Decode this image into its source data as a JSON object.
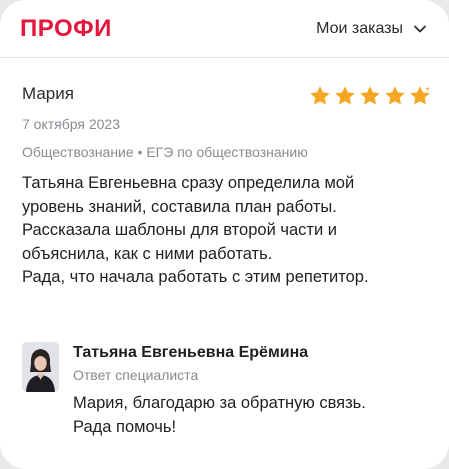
{
  "header": {
    "logo": "ПРОФИ",
    "orders_label": "Мои заказы"
  },
  "review": {
    "author": "Мария",
    "date": "7 октября 2023",
    "tags": "Обществознание • ЕГЭ по обществознанию",
    "rating": 4.5,
    "text_lines": [
      "Татьяна Евгеньевна сразу определила мой",
      "уровень знаний, составила план работы.",
      "Рассказала шаблоны для второй части и",
      "объяснила, как с ними работать.",
      "Рада, что начала работать с этим репетитор."
    ]
  },
  "reply": {
    "name": "Татьяна Евгеньевна Ерёмина",
    "role": "Ответ специалиста",
    "text_lines": [
      "Мария, благодарю за обратную связь.",
      "Рада помочь!"
    ]
  },
  "colors": {
    "brand": "#e3173b",
    "star": "#f5a623",
    "muted": "#8a8a92"
  }
}
